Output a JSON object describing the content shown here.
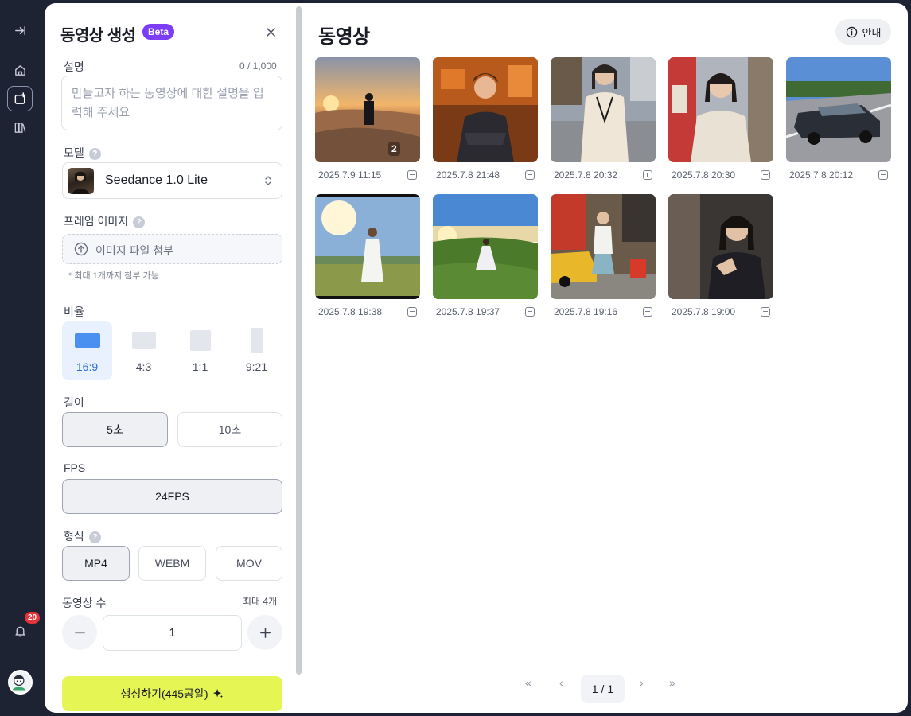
{
  "settings": {
    "title": "동영상 생성",
    "badge": "Beta",
    "description": {
      "label": "설명",
      "counter": "0 / 1,000",
      "placeholder": "만들고자 하는 동영상에 대한 설명을 입력해 주세요"
    },
    "model": {
      "label": "모델",
      "value": "Seedance 1.0 Lite"
    },
    "frame_image": {
      "label": "프레임 이미지",
      "upload_label": "이미지 파일 첨부",
      "note": "* 최대 1개까지 첨부 가능"
    },
    "ratio": {
      "label": "비율",
      "options": [
        "16:9",
        "4:3",
        "1:1",
        "9:21"
      ],
      "selected": "16:9"
    },
    "length": {
      "label": "길이",
      "options": [
        "5초",
        "10초"
      ],
      "selected": "5초"
    },
    "fps": {
      "label": "FPS",
      "value": "24FPS"
    },
    "format": {
      "label": "형식",
      "options": [
        "MP4",
        "WEBM",
        "MOV"
      ],
      "selected": "MP4"
    },
    "count": {
      "label": "동영상 수",
      "max_note": "최대 4개",
      "value": "1"
    },
    "generate_label": "생성하기(445콩알)"
  },
  "rail": {
    "notification_count": "20"
  },
  "gallery": {
    "title": "동영상",
    "info_label": "안내",
    "items": [
      {
        "date": "2025.7.9 11:15",
        "badge": "2",
        "orientation": "h",
        "scene": "desert sunset silhouette"
      },
      {
        "date": "2025.7.8 21:48",
        "orientation": "h",
        "scene": "animated man in lab"
      },
      {
        "date": "2025.7.8 20:32",
        "orientation": "v",
        "scene": "woman on street"
      },
      {
        "date": "2025.7.8 20:30",
        "orientation": "h",
        "scene": "woman selfie in alley"
      },
      {
        "date": "2025.7.8 20:12",
        "orientation": "h",
        "scene": "dark car on road"
      },
      {
        "date": "2025.7.8 19:38",
        "orientation": "h",
        "scene": "woman in white dress in field"
      },
      {
        "date": "2025.7.8 19:37",
        "orientation": "h",
        "scene": "woman on grassy hill"
      },
      {
        "date": "2025.7.8 19:16",
        "orientation": "h",
        "scene": "man by yellow taxi"
      },
      {
        "date": "2025.7.8 19:00",
        "orientation": "h",
        "scene": "woman with hand gesture"
      }
    ],
    "pagination": {
      "current": "1 / 1"
    }
  }
}
